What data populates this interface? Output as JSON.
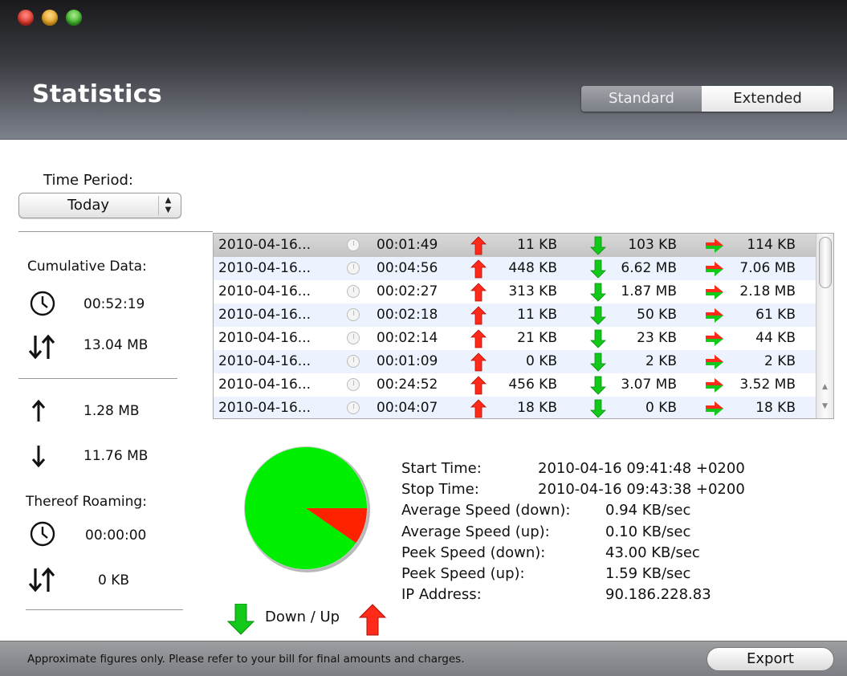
{
  "window": {
    "title": "Statistics",
    "view_modes": {
      "standard": "Standard",
      "extended": "Extended",
      "selected": "Standard"
    }
  },
  "time_period": {
    "label": "Time Period:",
    "value": "Today"
  },
  "cumulative": {
    "label": "Cumulative Data:",
    "duration": "00:52:19",
    "total": "13.04 MB",
    "upload": "1.28 MB",
    "download": "11.76 MB"
  },
  "roaming": {
    "label": "Thereof Roaming:",
    "duration": "00:00:00",
    "total": "0 KB"
  },
  "sessions": [
    {
      "date": "2010-04-16...",
      "duration": "00:01:49",
      "up": "11 KB",
      "down": "103 KB",
      "total": "114 KB"
    },
    {
      "date": "2010-04-16...",
      "duration": "00:04:56",
      "up": "448 KB",
      "down": "6.62 MB",
      "total": "7.06 MB"
    },
    {
      "date": "2010-04-16...",
      "duration": "00:02:27",
      "up": "313 KB",
      "down": "1.87 MB",
      "total": "2.18 MB"
    },
    {
      "date": "2010-04-16...",
      "duration": "00:02:18",
      "up": "11 KB",
      "down": "50 KB",
      "total": "61 KB"
    },
    {
      "date": "2010-04-16...",
      "duration": "00:02:14",
      "up": "21 KB",
      "down": "23 KB",
      "total": "44 KB"
    },
    {
      "date": "2010-04-16...",
      "duration": "00:01:09",
      "up": "0 KB",
      "down": "2 KB",
      "total": "2 KB"
    },
    {
      "date": "2010-04-16...",
      "duration": "00:24:52",
      "up": "456 KB",
      "down": "3.07 MB",
      "total": "3.52 MB"
    },
    {
      "date": "2010-04-16...",
      "duration": "00:04:07",
      "up": "18 KB",
      "down": "0 KB",
      "total": "18 KB"
    }
  ],
  "selected_row": 0,
  "chart_data": {
    "type": "pie",
    "labels": [
      "Down",
      "Up"
    ],
    "values": [
      103,
      11
    ],
    "colors": [
      "#00ee00",
      "#ff2200"
    ]
  },
  "legend": {
    "text": "Down / Up"
  },
  "details": {
    "start_time": {
      "label": "Start Time:",
      "value": "2010-04-16 09:41:48 +0200"
    },
    "stop_time": {
      "label": "Stop Time:",
      "value": "2010-04-16 09:43:38 +0200"
    },
    "avg_down": {
      "label": "Average Speed (down):",
      "value": "0.94 KB/sec"
    },
    "avg_up": {
      "label": "Average Speed (up):",
      "value": "0.10 KB/sec"
    },
    "peek_down": {
      "label": "Peek Speed (down):",
      "value": "43.00 KB/sec"
    },
    "peek_up": {
      "label": "Peek Speed (up):",
      "value": "1.59 KB/sec"
    },
    "ip": {
      "label": "IP Address:",
      "value": "90.186.228.83"
    }
  },
  "footer": {
    "note": "Approximate figures only. Please refer to your bill for final amounts and charges.",
    "export_label": "Export"
  },
  "icons": {
    "upload": "red-up-arrow-icon",
    "download": "green-down-arrow-icon",
    "total": "red-green-right-arrow-icon",
    "clock": "clock-icon",
    "updown": "up-down-arrows-icon"
  }
}
